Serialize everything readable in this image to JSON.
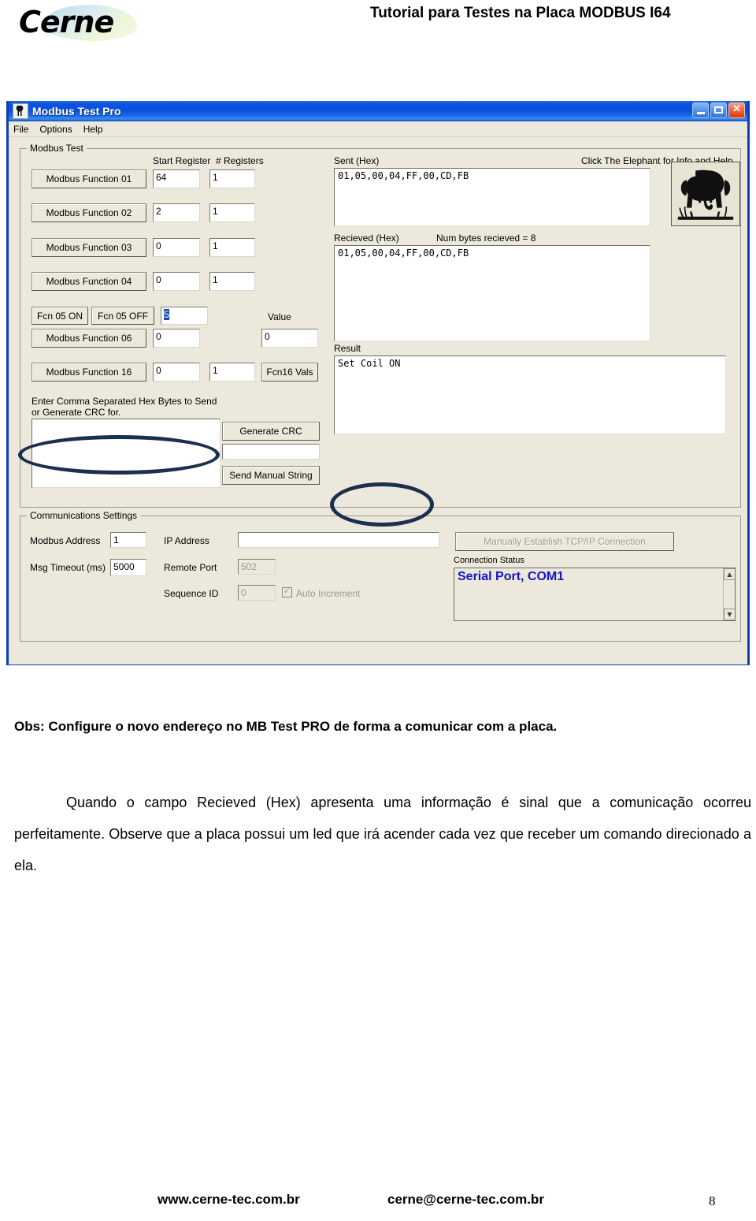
{
  "page": {
    "brand": "Cerne",
    "doc_title": "Tutorial para Testes na Placa MODBUS I64",
    "obs_line": "Obs: Configure o novo endereço no MB Test PRO de forma a comunicar com a placa.",
    "paragraph": "Quando o campo Recieved (Hex) apresenta uma informação é sinal que a comunicação ocorreu perfeitamente. Observe que a placa possui um led que irá acender cada vez que receber um comando direcionado a ela.",
    "footer_site": "www.cerne-tec.com.br",
    "footer_email": "cerne@cerne-tec.com.br",
    "footer_page": "8"
  },
  "window": {
    "title": "Modbus Test Pro",
    "icon": "app-icon",
    "buttons": {
      "minimize": "minimize-icon",
      "maximize": "maximize-icon",
      "close": "close-icon"
    },
    "menu": [
      "File",
      "Options",
      "Help"
    ]
  },
  "modbus_test": {
    "group_title": "Modbus Test",
    "col_headers": {
      "start_register": "Start Register",
      "num_registers": "# Registers",
      "value": "Value"
    },
    "rows": [
      {
        "button": "Modbus Function 01",
        "start_register": "64",
        "num_registers": "1"
      },
      {
        "button": "Modbus Function 02",
        "start_register": "2",
        "num_registers": "1"
      },
      {
        "button": "Modbus Function 03",
        "start_register": "0",
        "num_registers": "1"
      },
      {
        "button": "Modbus Function 04",
        "start_register": "0",
        "num_registers": "1"
      }
    ],
    "fcn05": {
      "on_button": "Fcn 05 ON",
      "off_button": "Fcn 05 OFF",
      "start_register": "5"
    },
    "fcn06": {
      "button": "Modbus Function 06",
      "start_register": "0",
      "value": "0"
    },
    "fcn16": {
      "button": "Modbus Function 16",
      "start_register": "0",
      "num_registers": "1",
      "vals_button": "Fcn16 Vals"
    },
    "manual": {
      "label_line1": "Enter Comma Separated Hex Bytes to Send",
      "label_line2": "or Generate CRC for.",
      "input": "",
      "crc_button": "Generate CRC",
      "crc_result": "",
      "send_button": "Send Manual String"
    },
    "sent": {
      "label": "Sent (Hex)",
      "value": "01,05,00,04,FF,00,CD,FB"
    },
    "received": {
      "label": "Recieved (Hex)",
      "num_bytes_label": "Num bytes recieved = 8",
      "value": "01,05,00,04,FF,00,CD,FB"
    },
    "result": {
      "label": "Result",
      "value": "Set Coil ON"
    },
    "elephant": {
      "hint": "Click The Elephant for Info and Help",
      "icon": "elephant-icon"
    }
  },
  "comms": {
    "group_title": "Communications Settings",
    "modbus_address": {
      "label": "Modbus Address",
      "value": "1"
    },
    "msg_timeout": {
      "label": "Msg Timeout (ms)",
      "value": "5000"
    },
    "ip_address": {
      "label": "IP Address",
      "value": ""
    },
    "remote_port": {
      "label": "Remote Port",
      "value": "502"
    },
    "sequence_id": {
      "label": "Sequence ID",
      "value": "0"
    },
    "auto_increment": {
      "label": "Auto Increment",
      "checked": true
    },
    "tcp_button": "Manually Establish TCP/IP Connection",
    "connection_status": {
      "label": "Connection Status",
      "value": "Serial Port, COM1"
    }
  },
  "colors": {
    "window_chrome": "#0a3fb5",
    "dialog_face": "#ece8db",
    "title_gradient_start": "#2a6fe0",
    "title_gradient_end": "#0c4bc0",
    "status_text": "#1414c8",
    "annotation": "#1b2f4e",
    "close_button": "#d8370d"
  }
}
